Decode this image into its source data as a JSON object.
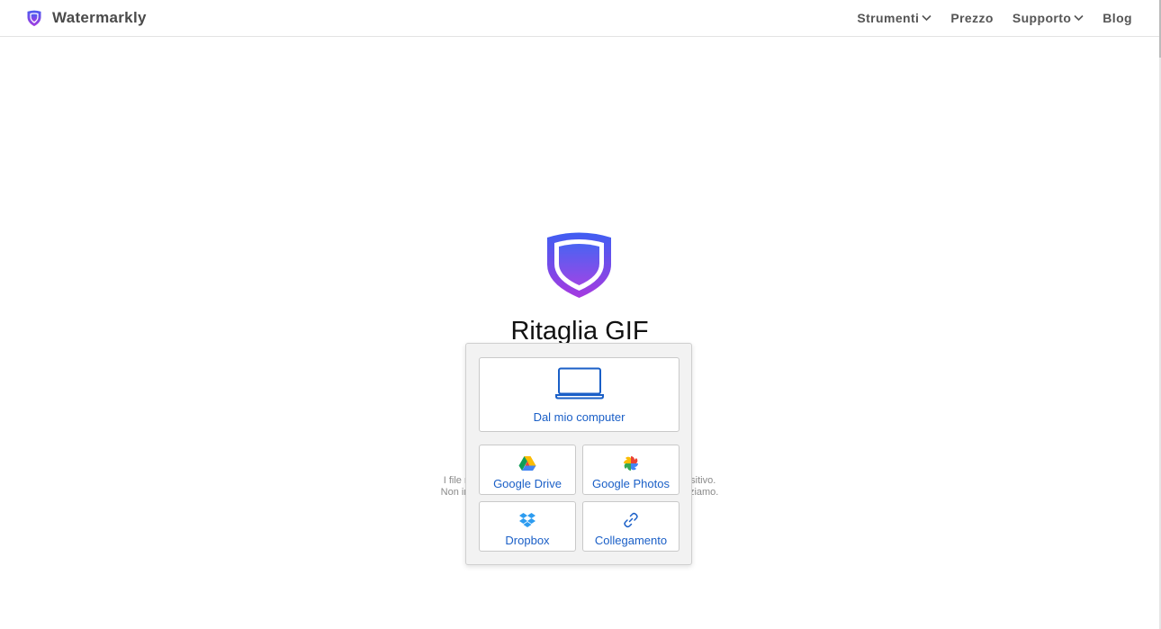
{
  "header": {
    "brand_name": "Watermarkly",
    "nav": [
      {
        "label": "Strumenti",
        "has_dropdown": true
      },
      {
        "label": "Prezzo",
        "has_dropdown": false
      },
      {
        "label": "Supporto",
        "has_dropdown": true
      },
      {
        "label": "Blog",
        "has_dropdown": false
      }
    ]
  },
  "hero": {
    "title": "Ritaglia GIF",
    "footnote_line1": "I file r                                                                                 sitivo.",
    "footnote_line2": "Non in                                                                                ziamo."
  },
  "upload_menu": {
    "computer": {
      "label": "Dal mio computer",
      "icon": "laptop-icon"
    },
    "google_drive": {
      "label": "Google Drive",
      "icon": "google-drive-icon"
    },
    "google_photos": {
      "label": "Google Photos",
      "icon": "google-photos-icon"
    },
    "dropbox": {
      "label": "Dropbox",
      "icon": "dropbox-icon"
    },
    "link": {
      "label": "Collegamento",
      "icon": "link-icon"
    }
  },
  "colors": {
    "accent_blue": "#1a5fc7",
    "logo_gradient_start": "#4b5cf0",
    "logo_gradient_end": "#a43ce0"
  }
}
